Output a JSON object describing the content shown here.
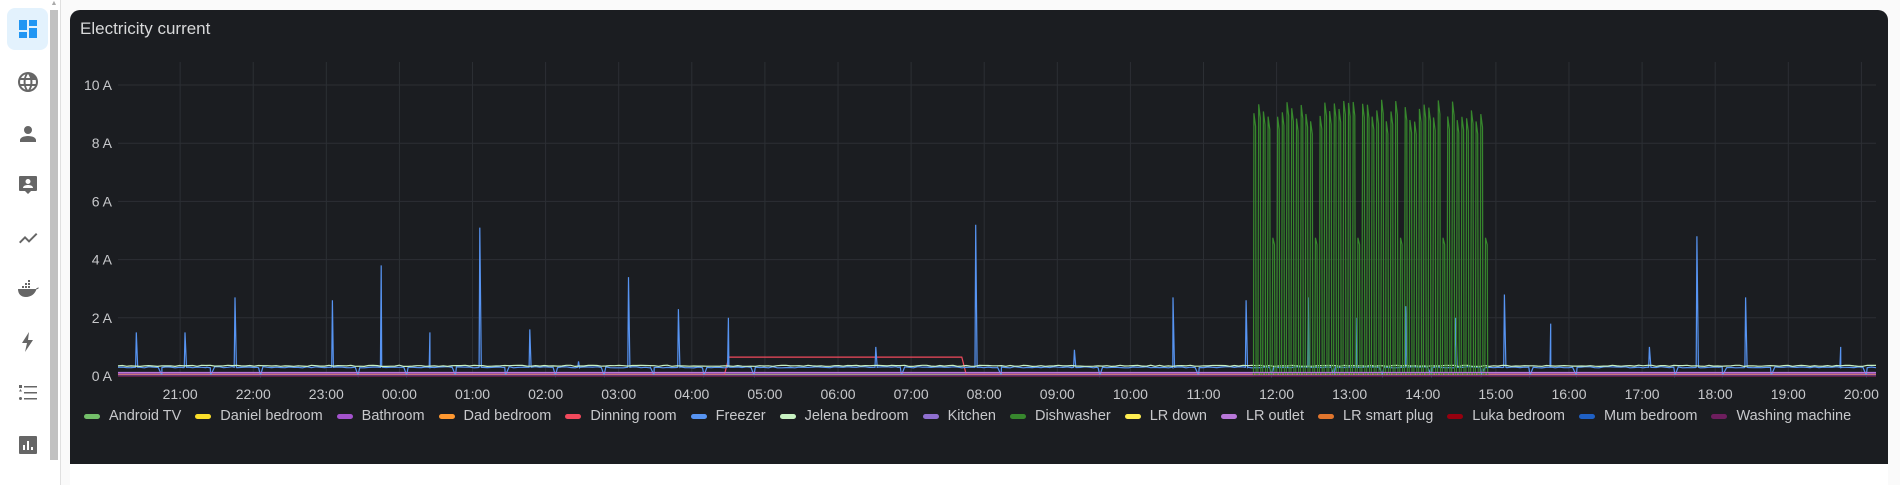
{
  "panel": {
    "title": "Electricity current"
  },
  "sidebar": {
    "items": [
      {
        "name": "dashboard-icon",
        "active": true
      },
      {
        "name": "globe-icon"
      },
      {
        "name": "person-icon"
      },
      {
        "name": "contact-card-icon"
      },
      {
        "name": "chart-line-icon"
      },
      {
        "name": "docker-icon"
      },
      {
        "name": "lightning-icon"
      },
      {
        "name": "list-icon"
      },
      {
        "name": "bar-chart-icon"
      }
    ]
  },
  "chart_data": {
    "type": "line",
    "title": "Electricity current",
    "xlabel": "",
    "ylabel": "",
    "x_range": [
      "20:09",
      "20:12"
    ],
    "ylim": [
      0,
      10
    ],
    "y_ticks": [
      "0 A",
      "2 A",
      "4 A",
      "6 A",
      "8 A",
      "10 A"
    ],
    "y_tick_values": [
      0,
      2,
      4,
      6,
      8,
      10
    ],
    "x_ticks": [
      "21:00",
      "22:00",
      "23:00",
      "00:00",
      "01:00",
      "02:00",
      "03:00",
      "04:00",
      "05:00",
      "06:00",
      "07:00",
      "08:00",
      "09:00",
      "10:00",
      "11:00",
      "12:00",
      "13:00",
      "14:00",
      "15:00",
      "16:00",
      "17:00",
      "18:00",
      "19:00",
      "20:00"
    ],
    "grid": true,
    "legend_position": "bottom",
    "series": [
      {
        "name": "Android TV",
        "color": "#73bf69",
        "baseline": 0.05
      },
      {
        "name": "Daniel bedroom",
        "color": "#fade2a",
        "baseline": 0.03
      },
      {
        "name": "Bathroom",
        "color": "#a352cc",
        "baseline": 0.1
      },
      {
        "name": "Dad bedroom",
        "color": "#ff9830",
        "baseline": 0.02
      },
      {
        "name": "Dinning room",
        "color": "#f2495c",
        "baseline": 0.05,
        "steps": [
          {
            "from": "04:30",
            "to": "07:45",
            "value": 0.65
          },
          {
            "from": "19:00",
            "to": "20:12",
            "value": 0.65
          }
        ]
      },
      {
        "name": "Freezer",
        "color": "#5794f2",
        "baseline": 0.3,
        "spikes": [
          [
            "20:24",
            1.5
          ],
          [
            "21:04",
            1.5
          ],
          [
            "21:45",
            2.7
          ],
          [
            "23:05",
            2.6
          ],
          [
            "23:45",
            3.8
          ],
          [
            "00:25",
            1.5
          ],
          [
            "01:06",
            5.1
          ],
          [
            "01:47",
            1.6
          ],
          [
            "02:27",
            0.5
          ],
          [
            "03:08",
            3.4
          ],
          [
            "03:49",
            2.3
          ],
          [
            "04:30",
            2.0
          ],
          [
            "06:31",
            1.0
          ],
          [
            "07:53",
            5.2
          ],
          [
            "09:14",
            0.9
          ],
          [
            "10:35",
            2.7
          ],
          [
            "11:35",
            2.6
          ],
          [
            "12:26",
            2.7
          ],
          [
            "13:06",
            2.0
          ],
          [
            "13:46",
            2.4
          ],
          [
            "14:27",
            2.0
          ],
          [
            "15:07",
            2.8
          ],
          [
            "15:45",
            1.8
          ],
          [
            "17:06",
            1.0
          ],
          [
            "17:45",
            4.8
          ],
          [
            "18:25",
            2.7
          ],
          [
            "19:43",
            1.0
          ]
        ]
      },
      {
        "name": "Jelena bedroom",
        "color": "#c8f2c2",
        "baseline": 0.35
      },
      {
        "name": "Kitchen",
        "color": "#8f6fd0",
        "baseline": 0.04
      },
      {
        "name": "Dishwasher",
        "color": "#37872d",
        "baseline": 0.0,
        "cycle": {
          "from": "11:41",
          "to": "14:55",
          "peak": 9.5,
          "cycles": 50
        }
      },
      {
        "name": "LR down",
        "color": "#ffee52",
        "baseline": 0.02
      },
      {
        "name": "LR outlet",
        "color": "#b877d9",
        "baseline": 0.12
      },
      {
        "name": "LR smart plug",
        "color": "#e0752d",
        "baseline": 0.02
      },
      {
        "name": "Luka bedroom",
        "color": "#96000f",
        "baseline": 0.0
      },
      {
        "name": "Mum bedroom",
        "color": "#1f60c4",
        "baseline": 0.01
      },
      {
        "name": "Washing machine",
        "color": "#6e1e5e",
        "baseline": 0.0
      }
    ]
  }
}
